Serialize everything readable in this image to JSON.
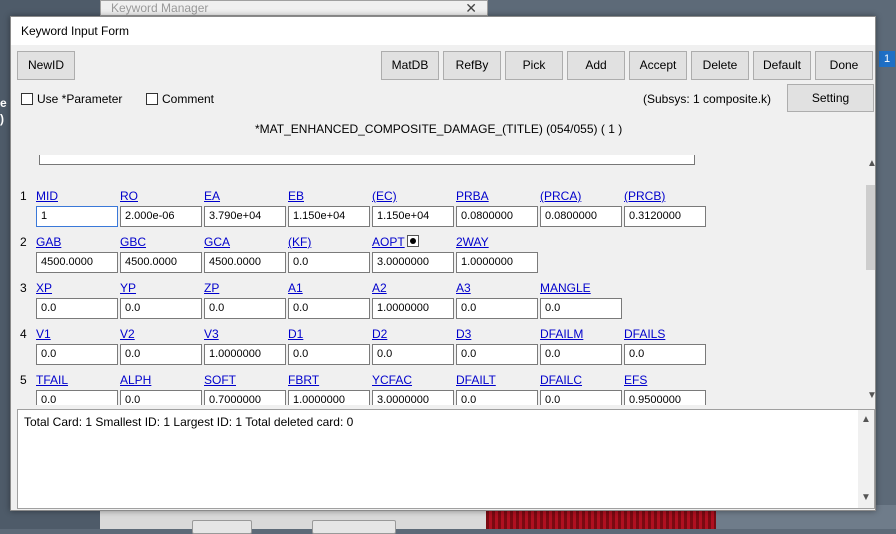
{
  "background": {
    "left_glyphs": [
      "e",
      ")"
    ],
    "badge": "1"
  },
  "keyword_manager": {
    "title": "Keyword Manager",
    "close": "✕"
  },
  "dialog": {
    "title": "Keyword Input Form",
    "toolbar": {
      "newid": "NewID",
      "matdb": "MatDB",
      "refby": "RefBy",
      "pick": "Pick",
      "add": "Add",
      "accept": "Accept",
      "delete": "Delete",
      "default": "Default",
      "done": "Done"
    },
    "options": {
      "use_parameter": "Use *Parameter",
      "comment": "Comment",
      "subsys": "(Subsys: 1 composite.k)",
      "setting": "Setting"
    },
    "keyword_title": "*MAT_ENHANCED_COMPOSITE_DAMAGE_(TITLE) (054/055)    ( 1 )",
    "cards": [
      {
        "num": "1",
        "labels": [
          "MID",
          "RO",
          "EA",
          "EB",
          "(EC)",
          "PRBA",
          "(PRCA)",
          "(PRCB)"
        ],
        "values": [
          "1",
          "2.000e-06",
          "3.790e+04",
          "1.150e+04",
          "1.150e+04",
          "0.0800000",
          "0.0800000",
          "0.3120000"
        ]
      },
      {
        "num": "2",
        "labels": [
          "GAB",
          "GBC",
          "GCA",
          "(KF)",
          "AOPT",
          "2WAY"
        ],
        "values": [
          "4500.0000",
          "4500.0000",
          "4500.0000",
          "0.0",
          "3.0000000",
          "1.0000000"
        ]
      },
      {
        "num": "3",
        "labels": [
          "XP",
          "YP",
          "ZP",
          "A1",
          "A2",
          "A3",
          "MANGLE"
        ],
        "values": [
          "0.0",
          "0.0",
          "0.0",
          "0.0",
          "1.0000000",
          "0.0",
          "0.0"
        ]
      },
      {
        "num": "4",
        "labels": [
          "V1",
          "V2",
          "V3",
          "D1",
          "D2",
          "D3",
          "DFAILM",
          "DFAILS"
        ],
        "values": [
          "0.0",
          "0.0",
          "1.0000000",
          "0.0",
          "0.0",
          "0.0",
          "0.0",
          "0.0"
        ]
      },
      {
        "num": "5",
        "labels": [
          "TFAIL",
          "ALPH",
          "SOFT",
          "FBRT",
          "YCFAC",
          "DFAILT",
          "DFAILC",
          "EFS"
        ],
        "values": [
          "0.0",
          "0.0",
          "0.7000000",
          "1.0000000",
          "3.0000000",
          "0.0",
          "0.0",
          "0.9500000"
        ]
      }
    ],
    "info": "Total Card: 1     Smallest ID: 1     Largest ID: 1     Total deleted card:  0"
  }
}
